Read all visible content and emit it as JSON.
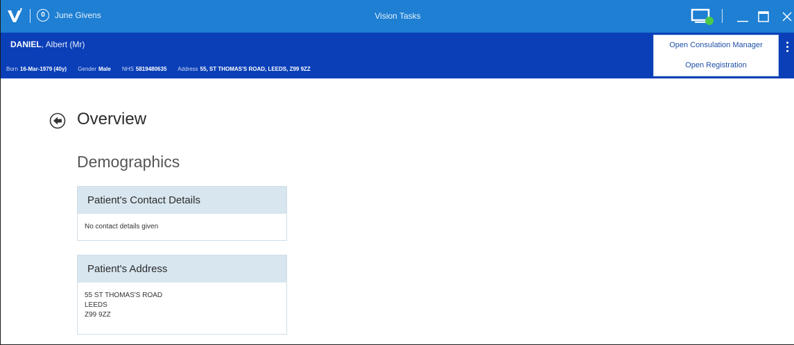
{
  "titlebar": {
    "user_count": "0",
    "user_name": "June Givens",
    "app_title": "Vision Tasks",
    "accent_color": "#1e7fd3",
    "icons": [
      "vision-logo-icon",
      "user-badge-icon",
      "monitor-status-icon",
      "minimize-icon",
      "maximize-icon",
      "close-icon"
    ]
  },
  "patient": {
    "surname": "DANIEL",
    "given": ", Albert (Mr)",
    "born_label": "Born",
    "born_value": "16-Mar-1979 (40y)",
    "gender_label": "Gender",
    "gender_value": "Male",
    "nhs_label": "NHS",
    "nhs_value": "5819480635",
    "address_label": "Address",
    "address_value": "55, ST THOMAS'S ROAD, LEEDS, Z99 9ZZ",
    "banner_color": "#0a3fb8"
  },
  "actions": {
    "consultation": "Open Consulation Manager",
    "registration": "Open Registration"
  },
  "main": {
    "title": "Overview",
    "section": "Demographics"
  },
  "contact_card": {
    "heading": "Patient's Contact Details",
    "text": "No contact details given"
  },
  "address_card": {
    "heading": "Patient's Address",
    "line1": "55 ST THOMAS'S ROAD",
    "line2": "LEEDS",
    "line3": "Z99 9ZZ"
  }
}
